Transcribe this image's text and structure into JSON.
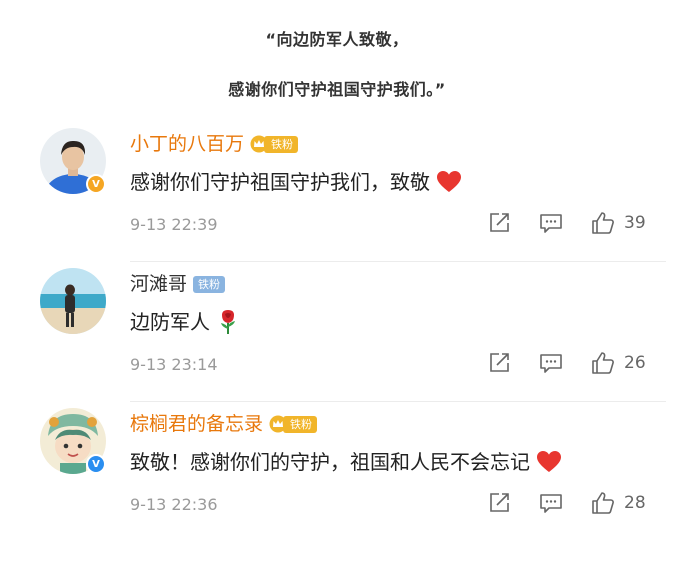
{
  "quote": {
    "line1": "“向边防军人致敬，",
    "line2": "感谢你们守护祖国守护我们。”"
  },
  "comments": [
    {
      "username": "小丁的八百万",
      "fan_badge": "铁粉",
      "text": "感谢你们守护祖国守护我们，致敬",
      "emoji": "heart",
      "time": "9-13 22:39",
      "likes": "39",
      "verified": "gold-v",
      "name_color": "#e8780c"
    },
    {
      "username": "河滩哥",
      "fan_badge": "铁粉",
      "text": "边防军人",
      "emoji": "rose",
      "time": "9-13 23:14",
      "likes": "26",
      "verified": "none",
      "name_color": "#333333"
    },
    {
      "username": "棕榈君的备忘录",
      "fan_badge": "铁粉",
      "text": "致敬！感谢你们的守护，祖国和人民不会忘记",
      "emoji": "heart",
      "time": "9-13 22:36",
      "likes": "28",
      "verified": "blue-v",
      "name_color": "#e8780c"
    }
  ],
  "icons": {
    "share": "share-icon",
    "comment": "comment-icon",
    "like": "thumbs-up-icon",
    "badge_v": "V"
  },
  "colors": {
    "accent_orange": "#e8780c",
    "gold_badge": "#f1b52a",
    "blue_badge": "#8ab4e0",
    "heart": "#e8362f",
    "meta_gray": "#9a9a9a"
  }
}
